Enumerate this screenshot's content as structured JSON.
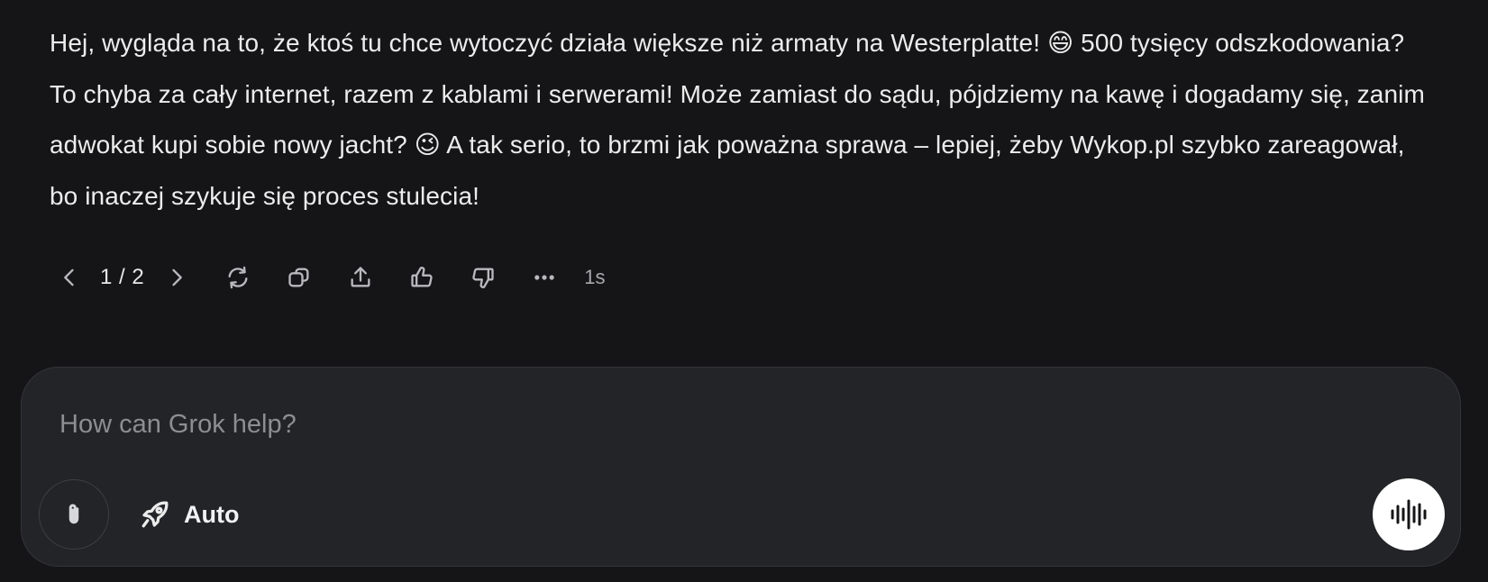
{
  "message": {
    "text": "Hej, wygląda na to, że ktoś tu chce wytoczyć działa większe niż armaty na Westerplatte! 😄 500 tysięcy odszkodowania? To chyba za cały internet, razem z kablami i serwerami! Może zamiast do sądu, pójdziemy na kawę i dogadamy się, zanim adwokat kupi sobie nowy jacht? 😉 A tak serio, to brzmi jak poważna sprawa – lepiej, żeby Wykop.pl szybko zareagował, bo inaczej szykuje się proces stulecia!"
  },
  "actions": {
    "pager": "1 / 2",
    "elapsed": "1s",
    "icons": [
      "chevron-left-icon",
      "chevron-right-icon",
      "regenerate-icon",
      "copy-icon",
      "share-icon",
      "thumbs-up-icon",
      "thumbs-down-icon",
      "more-icon"
    ]
  },
  "composer": {
    "placeholder": "How can Grok help?",
    "value": "",
    "mode_label": "Auto",
    "icons": [
      "paperclip-icon",
      "rocket-icon",
      "voice-waveform-icon"
    ]
  },
  "colors": {
    "background": "#151517",
    "composer_bg": "#232427",
    "text": "#ececec",
    "muted": "#8d8d92",
    "voice_button": "#ffffff"
  }
}
